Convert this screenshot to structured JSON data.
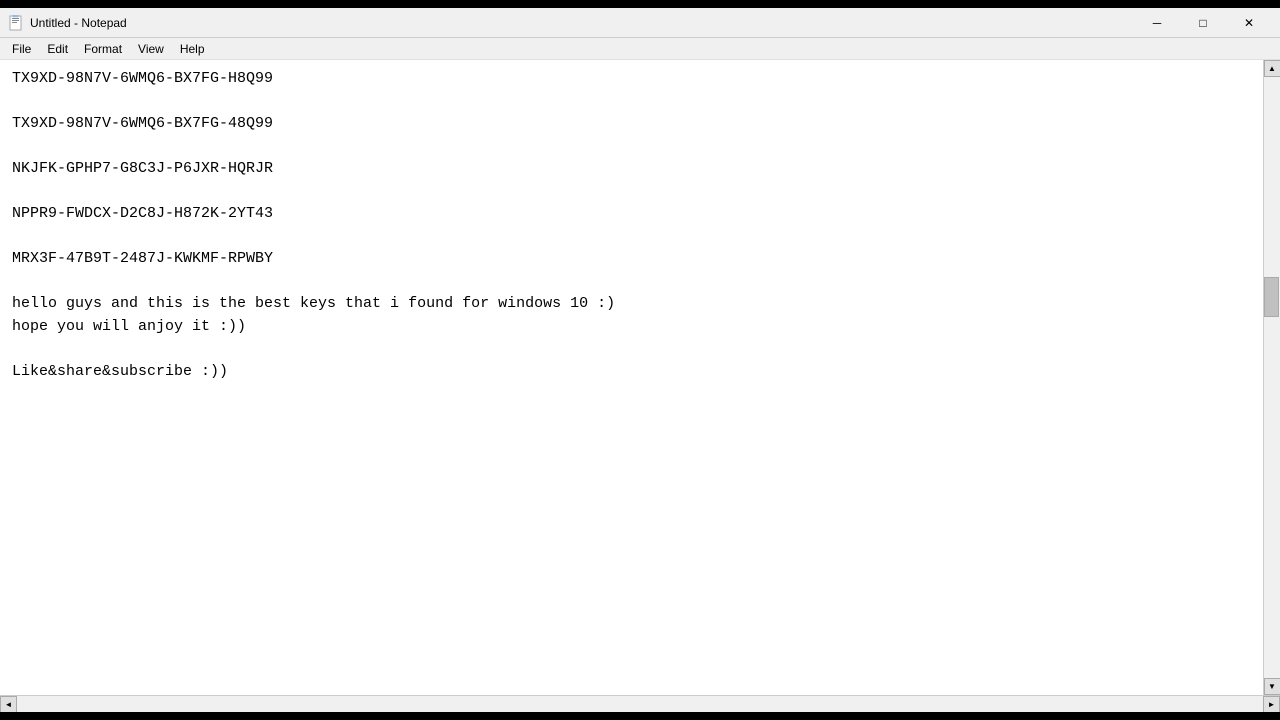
{
  "titleBar": {
    "icon": "notepad",
    "title": "Untitled - Notepad",
    "minimizeLabel": "─",
    "maximizeLabel": "□",
    "closeLabel": "✕"
  },
  "menuBar": {
    "items": [
      "File",
      "Edit",
      "Format",
      "View",
      "Help"
    ]
  },
  "editor": {
    "content": "TX9XD-98N7V-6WMQ6-BX7FG-H8Q99\n\nTX9XD-98N7V-6WMQ6-BX7FG-48Q99\n\nNKJFK-GPHP7-G8C3J-P6JXR-HQRJR\n\nNPPR9-FWDCX-D2C8J-H872K-2YT43\n\nMRX3F-47B9T-2487J-KWKMF-RPWBY\n\nhello guys and this is the best keys that i found for windows 10 :)\nhope you will anjoy it :))\n\nLike&share&subscribe :))"
  }
}
